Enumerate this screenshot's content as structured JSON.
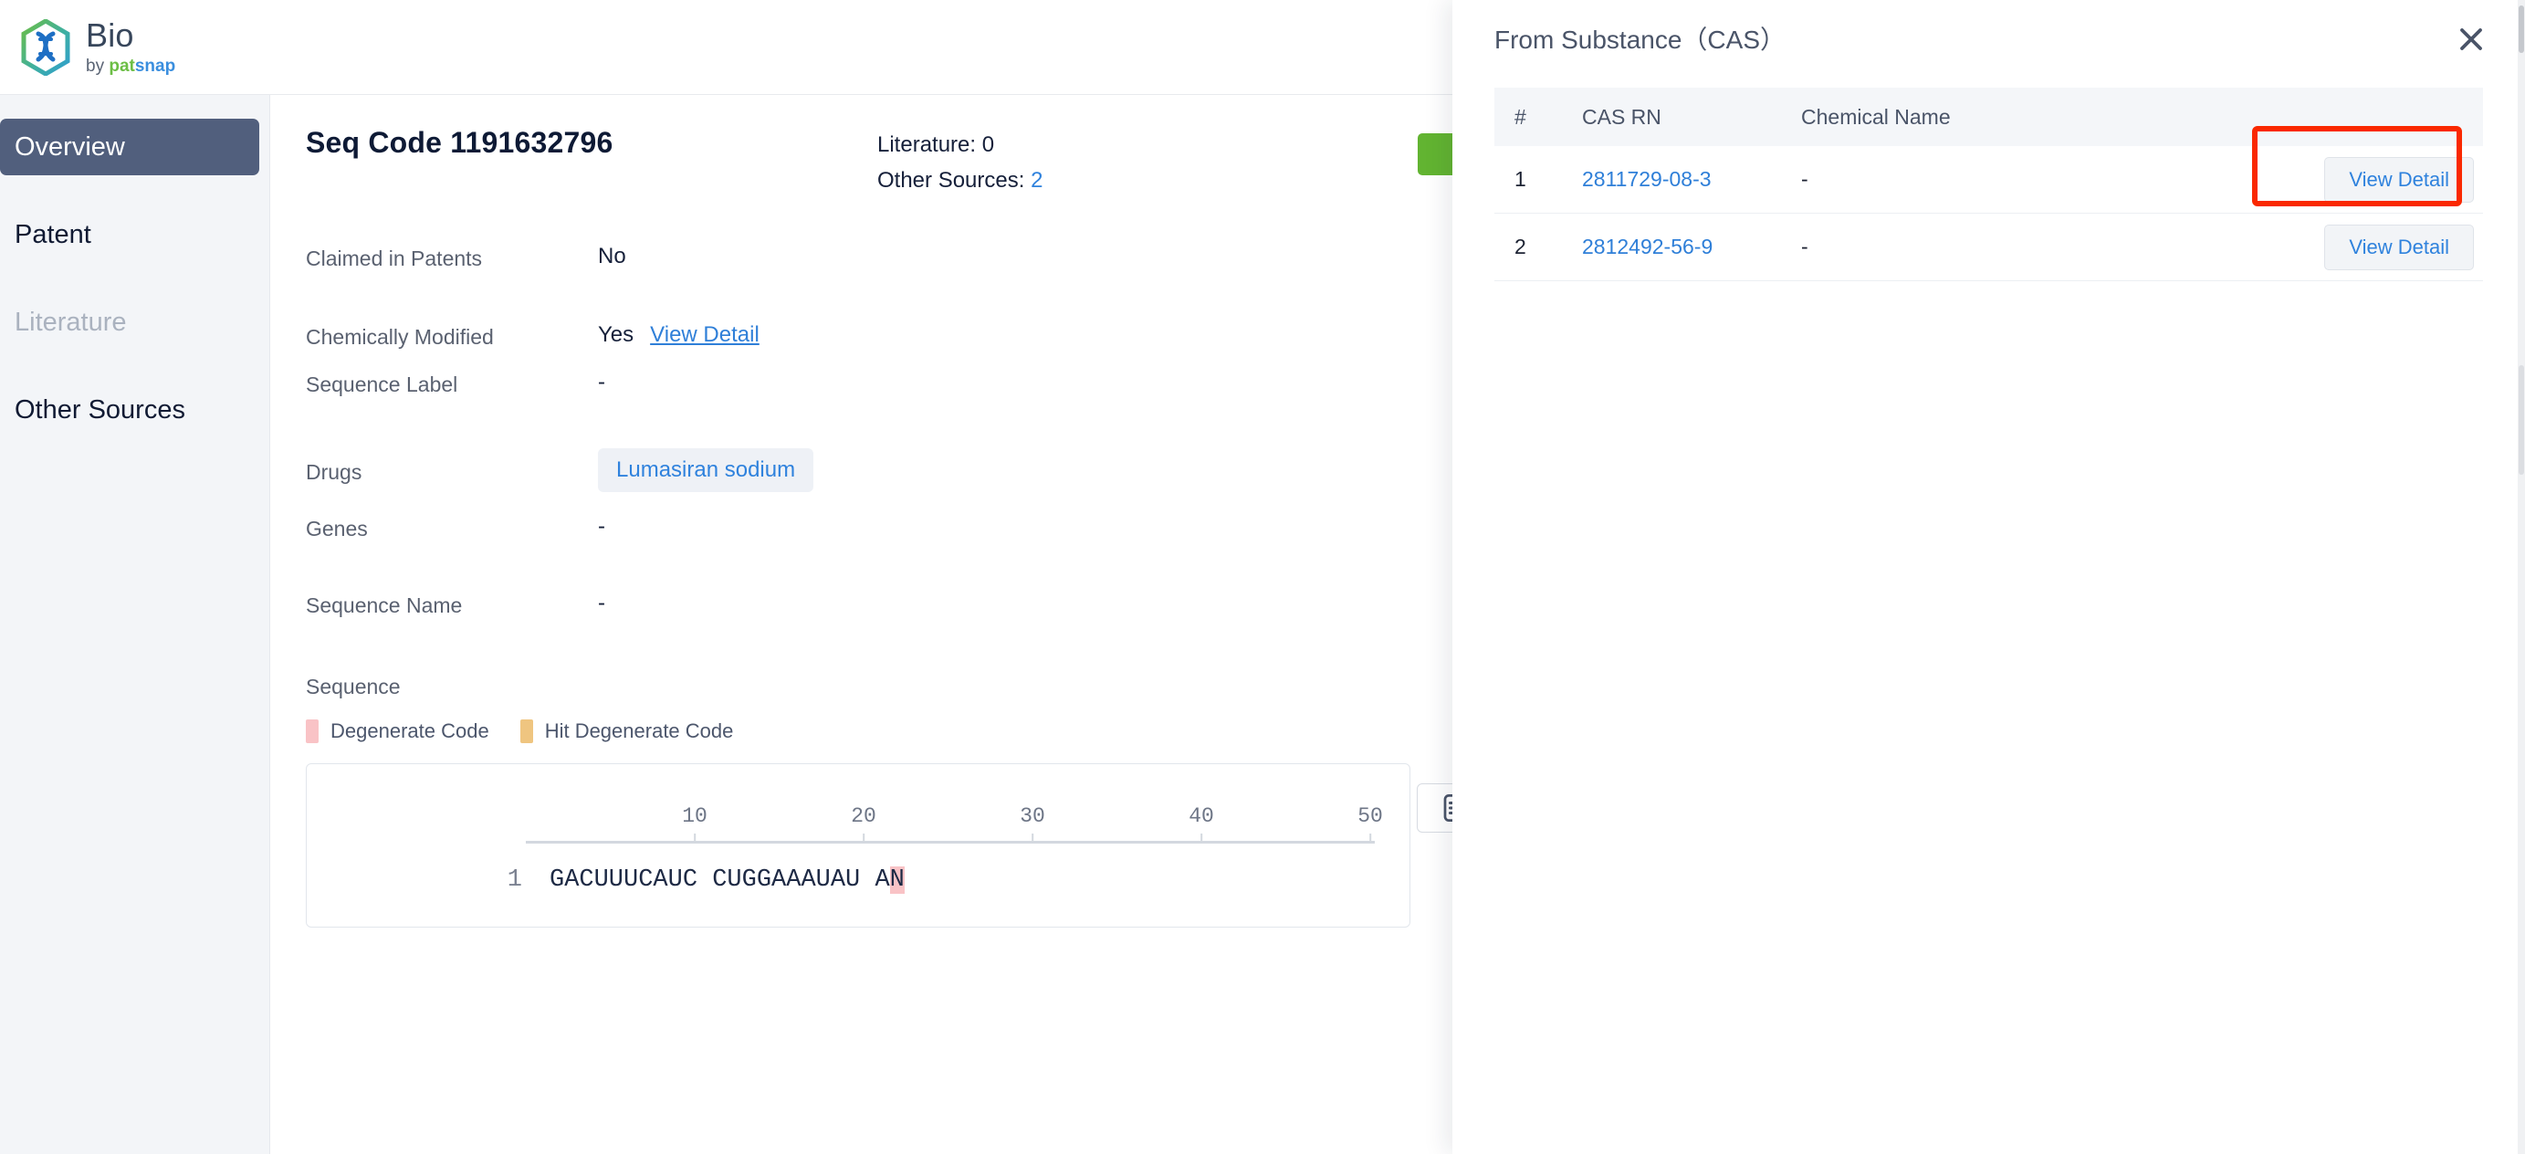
{
  "app": {
    "brand_title": "Bio",
    "brand_by": "by ",
    "brand_pat": "pat",
    "brand_snap": "snap",
    "logo_icon": "dna-hexagon-icon"
  },
  "sidebar": {
    "items": [
      {
        "label": "Overview",
        "state": "active"
      },
      {
        "label": "Patent",
        "state": "default"
      },
      {
        "label": "Literature",
        "state": "disabled"
      },
      {
        "label": "Other Sources",
        "state": "default"
      }
    ]
  },
  "main": {
    "page_title": "Seq Code 1191632796",
    "counts": {
      "literature_label": "Literature: ",
      "literature_value": "0",
      "other_sources_label": "Other Sources: ",
      "other_sources_value": "2"
    },
    "fields": [
      {
        "label": "Claimed in Patents",
        "value": "No"
      },
      {
        "label": "Chemically Modified",
        "value": "Yes",
        "link": "View Detail"
      },
      {
        "label": "Sequence Label",
        "value": "-"
      },
      {
        "label": "Drugs",
        "chip": "Lumasiran sodium"
      },
      {
        "label": "Genes",
        "value": "-"
      },
      {
        "label": "Sequence Name",
        "value": "-"
      }
    ],
    "sequence": {
      "section_label": "Sequence",
      "legend": [
        {
          "label": "Degenerate Code",
          "color": "#f9c3c6"
        },
        {
          "label": "Hit Degenerate Code",
          "color": "#efc580"
        }
      ],
      "ruler_ticks": [
        "10",
        "20",
        "30",
        "40",
        "50"
      ],
      "line_index": "1",
      "residues_plain": "GACUUUCAUC CUGGAAAUAU A",
      "residues_highlighted": "N"
    },
    "green_button_label": "",
    "list_icon": "list-view-icon"
  },
  "panel": {
    "title": "From Substance（CAS）",
    "close_icon": "close-icon",
    "columns": [
      "#",
      "CAS RN",
      "Chemical Name",
      ""
    ],
    "rows": [
      {
        "index": "1",
        "cas_rn": "2811729-08-3",
        "chemical_name": "-",
        "action": "View Detail"
      },
      {
        "index": "2",
        "cas_rn": "2812492-56-9",
        "chemical_name": "-",
        "action": "View Detail"
      }
    ]
  },
  "colors": {
    "accent_blue": "#2f82dd",
    "sidebar_active": "#515f7d",
    "annotation_red": "#fa2800",
    "green": "#62b431",
    "degenerate_pink": "#f9c3c6",
    "hit_degenerate_orange": "#efc580"
  }
}
